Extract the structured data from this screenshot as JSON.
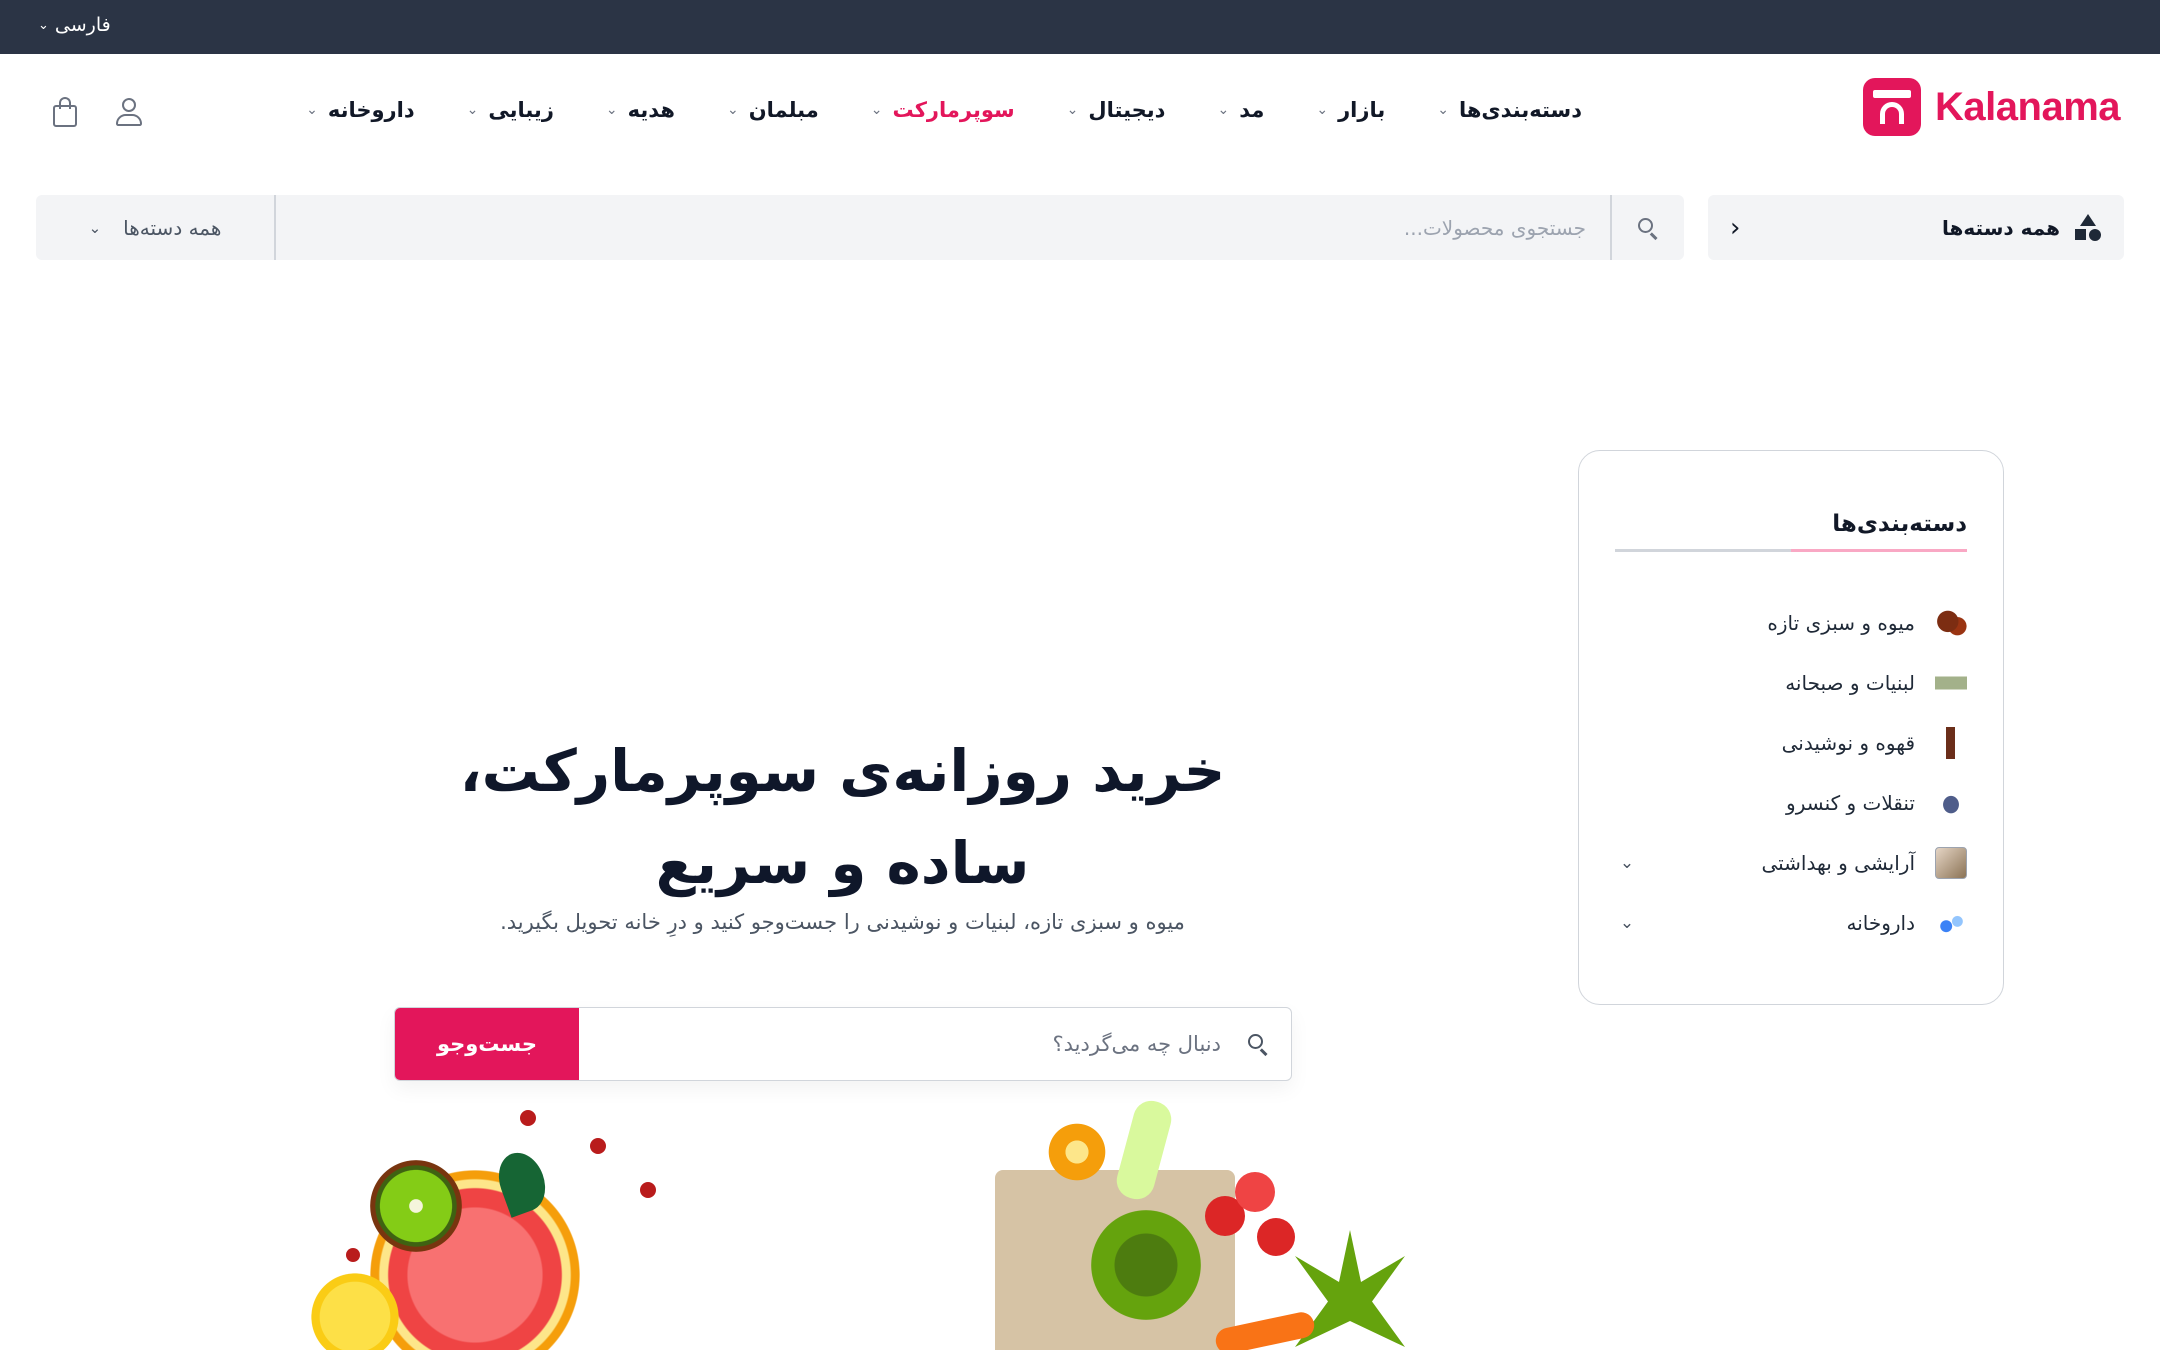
{
  "topbar": {
    "language": "فارسی"
  },
  "brand": {
    "name": "Kalanama",
    "color": "#e3165b"
  },
  "nav": {
    "items": [
      {
        "label": "دسته‌بندی‌ها",
        "active": false
      },
      {
        "label": "بازار",
        "active": false
      },
      {
        "label": "مد",
        "active": false
      },
      {
        "label": "دیجیتال",
        "active": false
      },
      {
        "label": "سوپرمارکت",
        "active": true
      },
      {
        "label": "مبلمان",
        "active": false
      },
      {
        "label": "هدیه",
        "active": false
      },
      {
        "label": "زیبایی",
        "active": false
      },
      {
        "label": "داروخانه",
        "active": false
      }
    ]
  },
  "header_icons": [
    "user-icon",
    "shopping-bag-icon"
  ],
  "search": {
    "all_categories_label": "همه دسته‌ها",
    "placeholder": "جستجوی محصولات...",
    "category_select": "همه دسته‌ها"
  },
  "sidebar": {
    "title": "دسته‌بندی‌ها",
    "items": [
      {
        "label": "میوه و سبزی تازه",
        "icon": "fruit-thumbnail",
        "expandable": false
      },
      {
        "label": "لبنیات و صبحانه",
        "icon": "dairy-thumbnail",
        "expandable": false
      },
      {
        "label": "قهوه و نوشیدنی",
        "icon": "coffee-thumbnail",
        "expandable": false
      },
      {
        "label": "تنقلات و کنسرو",
        "icon": "snack-thumbnail",
        "expandable": false
      },
      {
        "label": "آرایشی و بهداشتی",
        "icon": "beauty-thumbnail",
        "expandable": true
      },
      {
        "label": "داروخانه",
        "icon": "pharmacy-thumbnail",
        "expandable": true
      }
    ]
  },
  "hero": {
    "title": "خرید روزانه‌ی سوپرمارکت، ساده و سریع",
    "subtitle": "میوه و سبزی تازه، لبنیات و نوشیدنی را جست‌وجو کنید و درِ خانه تحویل بگیرید.",
    "search_placeholder": "دنبال چه می‌گردید؟",
    "search_button": "جست‌وجو"
  },
  "colors": {
    "accent": "#e3165b",
    "topbar": "#2b3445",
    "surface": "#f3f4f6"
  }
}
